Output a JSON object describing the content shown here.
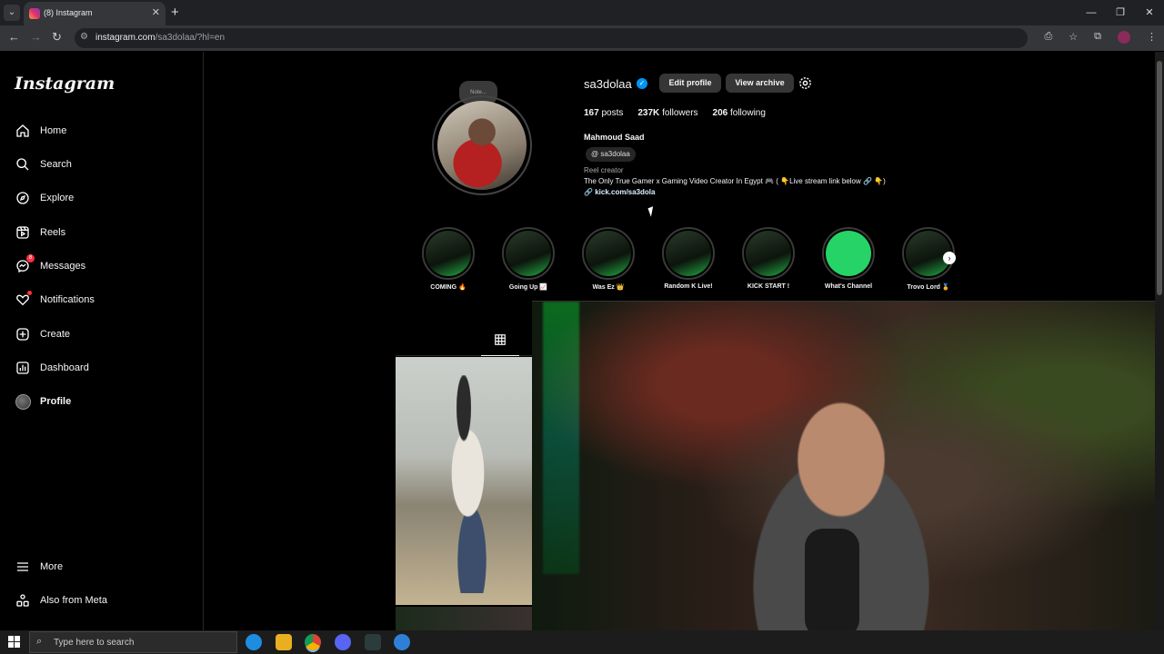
{
  "browser": {
    "tab_title": "(8) Instagram",
    "url_host": "instagram.com",
    "url_path": "/sa3dolaa/?hl=en"
  },
  "sidebar": {
    "logo": "Instagram",
    "items": [
      {
        "label": "Home",
        "icon": "home-icon"
      },
      {
        "label": "Search",
        "icon": "search-icon"
      },
      {
        "label": "Explore",
        "icon": "compass-icon"
      },
      {
        "label": "Reels",
        "icon": "reels-icon"
      },
      {
        "label": "Messages",
        "icon": "messenger-icon",
        "badge": "8"
      },
      {
        "label": "Notifications",
        "icon": "heart-icon"
      },
      {
        "label": "Create",
        "icon": "plus-square-icon"
      },
      {
        "label": "Dashboard",
        "icon": "dashboard-icon"
      },
      {
        "label": "Profile",
        "icon": "avatar"
      }
    ],
    "more": "More",
    "meta": "Also from Meta"
  },
  "profile": {
    "note": "Note...",
    "username": "sa3dolaa",
    "edit_profile": "Edit profile",
    "view_archive": "View archive",
    "posts_count": "167",
    "posts_label": "posts",
    "followers_count": "237K",
    "followers_label": "followers",
    "following_count": "206",
    "following_label": "following",
    "full_name": "Mahmoud Saad",
    "threads_handle": "sa3dolaa",
    "category": "Reel creator",
    "bio": "The Only True Gamer x Gaming Video Creator In Egypt 🎮 ( 👇Live stream link below 🔗 👇)",
    "link": "kick.com/sa3dola"
  },
  "highlights": [
    {
      "label": "COMING 🔥"
    },
    {
      "label": "Going Up 📈"
    },
    {
      "label": "Was Ez 👑"
    },
    {
      "label": "Random K Live!"
    },
    {
      "label": "KICK START !"
    },
    {
      "label": "What's Channel"
    },
    {
      "label": "Trovo Lord 🏅"
    }
  ],
  "taskbar": {
    "search_placeholder": "Type here to search"
  }
}
